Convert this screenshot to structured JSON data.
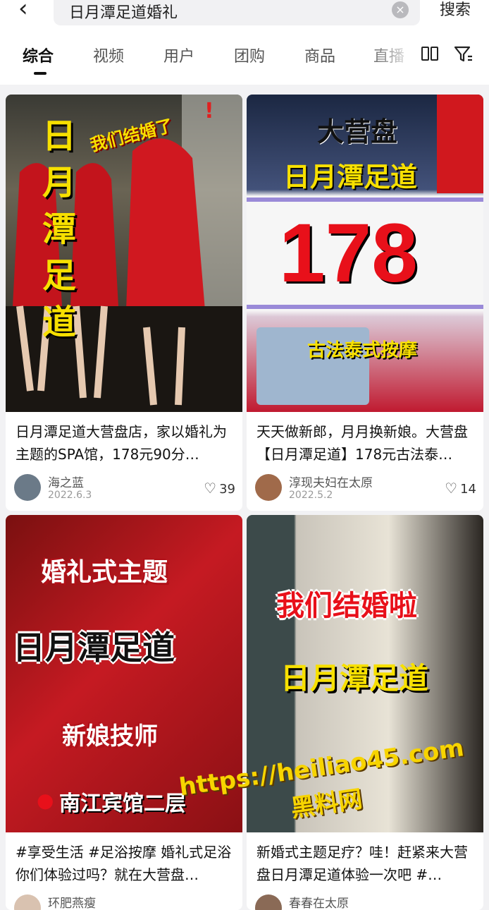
{
  "search": {
    "query": "日月潭足道婚礼",
    "submit_label": "搜索"
  },
  "tabs": [
    {
      "label": "综合"
    },
    {
      "label": "视频"
    },
    {
      "label": "用户"
    },
    {
      "label": "团购"
    },
    {
      "label": "商品"
    },
    {
      "label": "直播"
    }
  ],
  "cards": [
    {
      "overlay": [
        "我们结婚了",
        "日",
        "月",
        "潭",
        "足",
        "道"
      ],
      "caption": "日月潭足道大营盘店，家以婚礼为主题的SPA馆，178元90分…",
      "user": "海之蓝",
      "date": "2022.6.3",
      "likes": "39"
    },
    {
      "overlay": [
        "大营盘",
        "日月潭足道",
        "178",
        "古法泰式按摩"
      ],
      "caption": "天天做新郎，月月换新娘。大营盘【日月潭足道】178元古法泰…",
      "user": "淳现夫妇在太原",
      "date": "2022.5.2",
      "likes": "14"
    },
    {
      "overlay": [
        "婚礼式主题",
        "日月潭足道",
        "新娘技师",
        "南江宾馆二层"
      ],
      "caption": "#享受生活 #足浴按摩 婚礼式足浴你们体验过吗？就在大营盘…",
      "user": "环肥燕瘦"
    },
    {
      "overlay": [
        "我们结婚啦",
        "日月潭足道"
      ],
      "caption": "新婚式主题足疗？哇！赶紧来大营盘日月潭足道体验一次吧 #…",
      "user": "春春在太原"
    }
  ],
  "watermark": {
    "line1": "https://heiliao45.com",
    "line2": "黑料网"
  }
}
